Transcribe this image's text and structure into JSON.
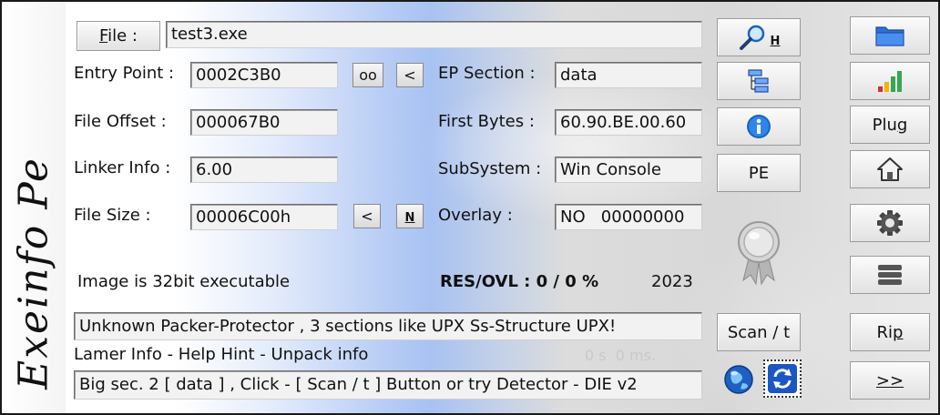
{
  "file": {
    "button_prefix": "F",
    "button_rest": "ile :",
    "name": "test3.exe"
  },
  "fields": {
    "entry_point_label": "Entry Point :",
    "entry_point_value": "0002C3B0",
    "oo_label": "oo",
    "lt_label": "<",
    "file_offset_label": "File Offset :",
    "file_offset_value": "000067B0",
    "linker_info_label": "Linker Info :",
    "linker_info_value": "6.00",
    "file_size_label": "File Size :",
    "file_size_value": "00006C00h",
    "size_lt_label": "<",
    "size_n_label": "N",
    "ep_section_label": "EP Section :",
    "ep_section_value": "data",
    "first_bytes_label": "First Bytes :",
    "first_bytes_value": "60.90.BE.00.60",
    "subsystem_label": "SubSystem :",
    "subsystem_value": "Win Console",
    "overlay_label": "Overlay :",
    "overlay_value": "NO   00000000"
  },
  "info": {
    "image_text": "Image is 32bit executable",
    "res_ovl": "RES/OVL : 0 / 0 %",
    "year": "2023",
    "detection": "Unknown Packer-Protector , 3 sections  like UPX  Ss-Structure UPX!",
    "hint_label": "Lamer Info - Help Hint - Unpack info",
    "hint_value": "Big sec. 2 [ data ] , Click - [ Scan / t ]  Button  or  try Detector - DIE v2",
    "time_text": "0 s  0 ms."
  },
  "toolbar": {
    "search_h": "H",
    "pe_label": "PE",
    "scan_label": "Scan / t",
    "plug_prefix": "Plu",
    "plug_underlined": "g",
    "rip_prefix": "Ri",
    "rip_underlined": "p",
    "next_label": ">>"
  },
  "icons": {
    "search": "magnifier-icon",
    "tree": "tree-structure-icon",
    "info": "info-icon",
    "folder": "folder-icon",
    "signal": "signal-bars-icon",
    "home": "home-icon",
    "gear": "gear-icon",
    "menu": "stack-icon",
    "badge": "award-badge-icon",
    "globe": "globe-icon",
    "refresh": "refresh-icon"
  },
  "colors": {
    "accent_blue": "#1565c0",
    "signal_red": "#d32f2f",
    "signal_yellow": "#f4b400",
    "signal_green": "#34a853"
  }
}
